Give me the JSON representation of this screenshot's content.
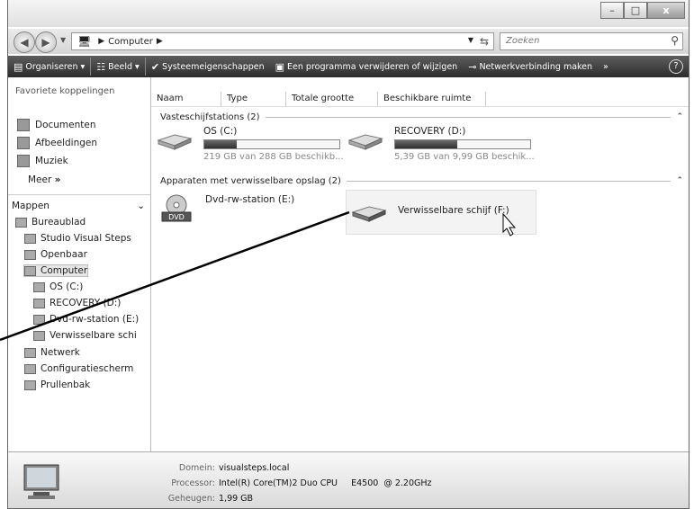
{
  "window": {
    "buttons": {
      "minimize": "–",
      "maximize": "□",
      "close": "x"
    }
  },
  "address": {
    "crumb": "Computer",
    "search_placeholder": "Zoeken"
  },
  "toolbar": {
    "organize": "Organiseren ▾",
    "views": "Beeld ▾",
    "system_props": "Systeemeigenschappen",
    "uninstall": "Een programma verwijderen of wijzigen",
    "map_drive": "Netwerkverbinding maken",
    "more": "»",
    "help": "?"
  },
  "sidebar": {
    "favorites_header": "Favoriete koppelingen",
    "favorites": [
      {
        "label": "Documenten",
        "icon": "documents-icon"
      },
      {
        "label": "Afbeeldingen",
        "icon": "pictures-icon"
      },
      {
        "label": "Muziek",
        "icon": "music-icon"
      }
    ],
    "more_label": "Meer",
    "more_arrows": "»",
    "folders_header": "Mappen",
    "folders_chevron": "⌄",
    "tree": [
      {
        "label": "Bureaublad",
        "icon": "desktop-icon"
      },
      {
        "label": "Studio Visual Steps",
        "icon": "user-folder-icon"
      },
      {
        "label": "Openbaar",
        "icon": "public-folder-icon"
      },
      {
        "label": "Computer",
        "icon": "computer-icon"
      },
      {
        "label": "OS (C:)",
        "icon": "hard-drive-icon"
      },
      {
        "label": "RECOVERY (D:)",
        "icon": "hard-drive-icon"
      },
      {
        "label": "Dvd-rw-station (E:)",
        "icon": "dvd-drive-icon"
      },
      {
        "label": "Verwisselbare schi",
        "icon": "removable-drive-icon"
      },
      {
        "label": "Netwerk",
        "icon": "network-icon"
      },
      {
        "label": "Configuratiescherm",
        "icon": "control-panel-icon"
      },
      {
        "label": "Prullenbak",
        "icon": "recycle-bin-icon"
      }
    ]
  },
  "columns": [
    "Naam",
    "Type",
    "Totale grootte",
    "Beschikbare ruimte"
  ],
  "groups": {
    "hard_drives": "Vasteschijfstations (2)",
    "removable": "Apparaten met verwisselbare opslag (2)",
    "collapse_icon": "⌃"
  },
  "drives": [
    {
      "name": "OS (C:)",
      "free_text": "219 GB van 288 GB beschikb...",
      "used_fraction": 0.24
    },
    {
      "name": "RECOVERY (D:)",
      "free_text": "5,39 GB van 9,99 GB beschik...",
      "used_fraction": 0.46
    }
  ],
  "devices": [
    {
      "name": "Dvd-rw-station (E:)",
      "badge": "DVD"
    },
    {
      "name": "Verwisselbare schijf (F:)"
    }
  ],
  "details": {
    "domain_label": "Domein:",
    "domain_value": "visualsteps.local",
    "cpu_label": "Processor:",
    "cpu_value": "Intel(R) Core(TM)2 Duo CPU     E4500  @ 2.20GHz",
    "mem_label": "Geheugen:",
    "mem_value": "1,99 GB"
  }
}
